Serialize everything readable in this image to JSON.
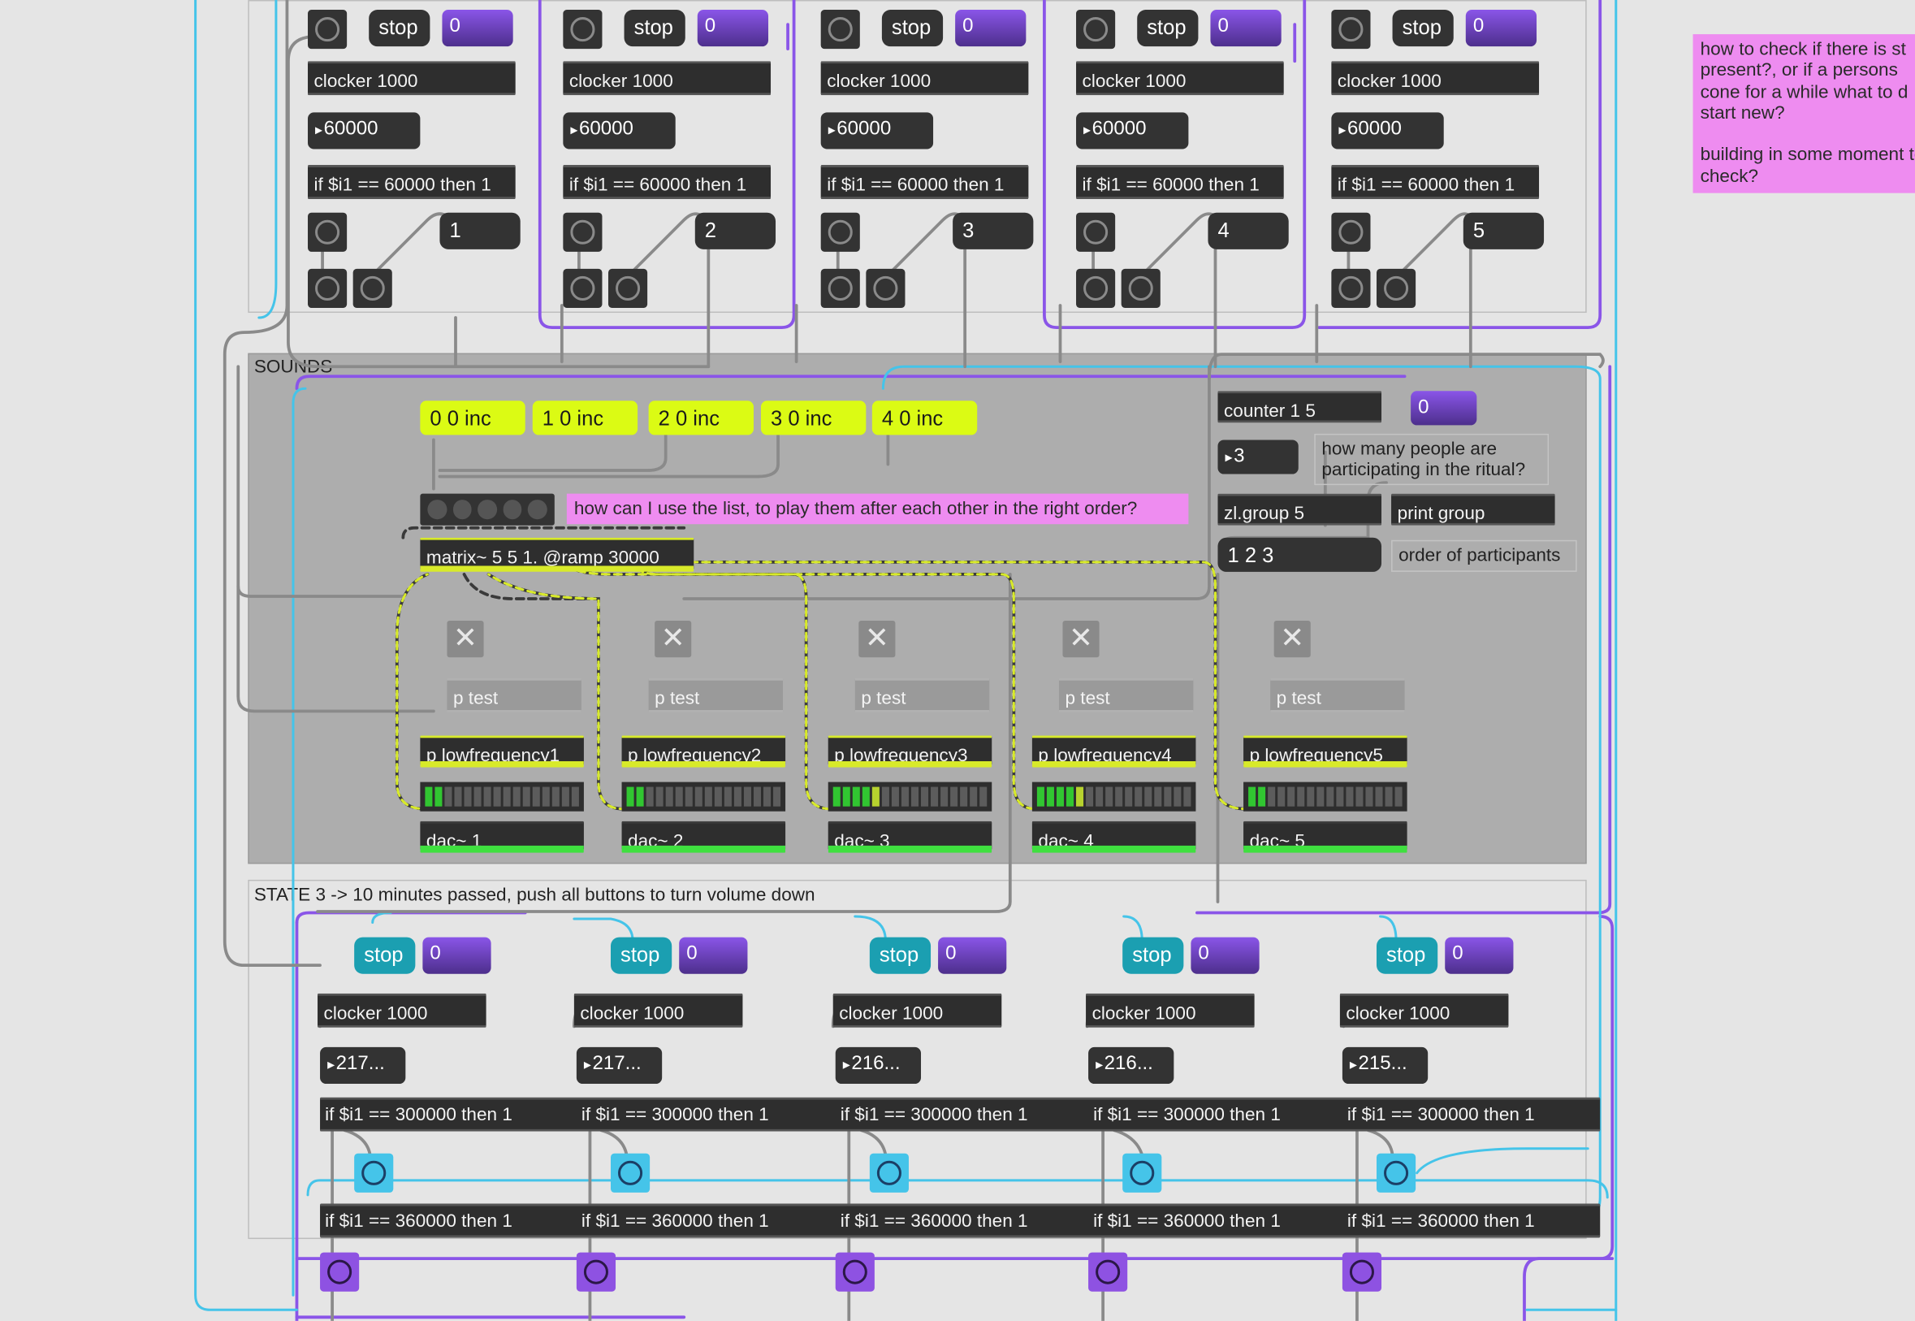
{
  "colors": {
    "canvas": "#e5e5e5",
    "panel_dark": "#aeaeae",
    "purple_patchcord": "#8a55e8",
    "cyan_patchcord": "#45c4e9",
    "yellow_signal": "#dbfb14",
    "pink_comment": "#ee8cf0"
  },
  "icons": {
    "bang": "circle-button-icon",
    "toggle": "x-toggle-icon",
    "number": "triangle-arrow-icon"
  },
  "state2": {
    "columns": [
      {
        "stop": "stop",
        "num": "0",
        "clocker": "clocker 1000",
        "counter": "60000",
        "cond": "if $i1 == 60000 then 1",
        "out_msg": "1"
      },
      {
        "stop": "stop",
        "num": "0",
        "clocker": "clocker 1000",
        "counter": "60000",
        "cond": "if $i1 == 60000 then 1",
        "out_msg": "2"
      },
      {
        "stop": "stop",
        "num": "0",
        "clocker": "clocker 1000",
        "counter": "60000",
        "cond": "if $i1 == 60000 then 1",
        "out_msg": "3"
      },
      {
        "stop": "stop",
        "num": "0",
        "clocker": "clocker 1000",
        "counter": "60000",
        "cond": "if $i1 == 60000 then 1",
        "out_msg": "4"
      },
      {
        "stop": "stop",
        "num": "0",
        "clocker": "clocker 1000",
        "counter": "60000",
        "cond": "if $i1 == 60000 then 1",
        "out_msg": "5"
      }
    ]
  },
  "notes": {
    "top_right": "how to check if there is st present?, or if a persons cone for a while what to d start new?\n\nbuilding in some moment to check?",
    "list_question": "how can I use the list, to play them after each other in the right order?",
    "participants_question": "how many people are participating in the ritual?",
    "order_label": "order of participants"
  },
  "sounds": {
    "title": "SOUNDS",
    "inc_msgs": [
      "0 0 inc",
      "1 0 inc",
      "2 0 inc",
      "3 0 inc",
      "4 0 inc"
    ],
    "matrix": "matrix~ 5 5 1. @ramp 30000",
    "counter": "counter 1 5",
    "counter_num": "0",
    "participants_num": "3",
    "zl": "zl.group 5",
    "print": "print group",
    "order_msg": "1 2 3",
    "voices": [
      {
        "test": "p test",
        "low": "p lowfrequency1",
        "dac": "dac~ 1",
        "meter_level": 0.13
      },
      {
        "test": "p test",
        "low": "p lowfrequency2",
        "dac": "dac~ 2",
        "meter_level": 0.13
      },
      {
        "test": "p test",
        "low": "p lowfrequency3",
        "dac": "dac~ 3",
        "meter_level": 0.3
      },
      {
        "test": "p test",
        "low": "p lowfrequency4",
        "dac": "dac~ 4",
        "meter_level": 0.3
      },
      {
        "test": "p test",
        "low": "p lowfrequency5",
        "dac": "dac~ 5",
        "meter_level": 0.13
      }
    ]
  },
  "state3": {
    "title": "STATE 3  -> 10 minutes passed, push all buttons to turn volume down",
    "columns": [
      {
        "stop": "stop",
        "num": "0",
        "clocker": "clocker 1000",
        "counter": "217...",
        "cond1": "if $i1 == 300000 then 1",
        "cond2": "if $i1 == 360000 then 1"
      },
      {
        "stop": "stop",
        "num": "0",
        "clocker": "clocker 1000",
        "counter": "217...",
        "cond1": "if $i1 == 300000 then 1",
        "cond2": "if $i1 == 360000 then 1"
      },
      {
        "stop": "stop",
        "num": "0",
        "clocker": "clocker 1000",
        "counter": "216...",
        "cond1": "if $i1 == 300000 then 1",
        "cond2": "if $i1 == 360000 then 1"
      },
      {
        "stop": "stop",
        "num": "0",
        "clocker": "clocker 1000",
        "counter": "216...",
        "cond1": "if $i1 == 300000 then 1",
        "cond2": "if $i1 == 360000 then 1"
      },
      {
        "stop": "stop",
        "num": "0",
        "clocker": "clocker 1000",
        "counter": "215...",
        "cond1": "if $i1 == 300000 then 1",
        "cond2": "if $i1 == 360000 then 1"
      }
    ]
  }
}
